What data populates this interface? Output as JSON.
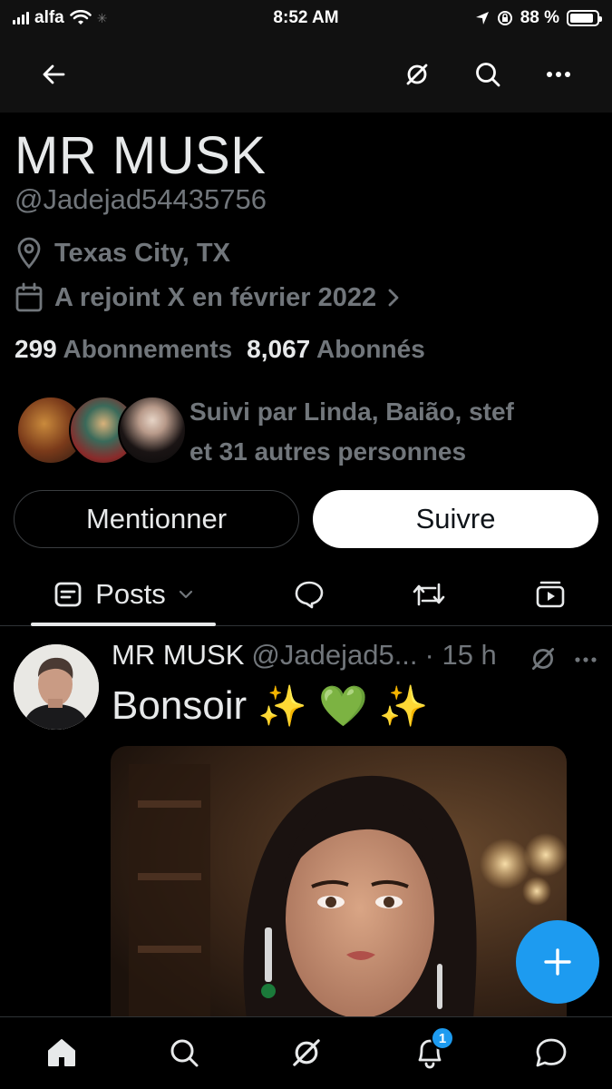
{
  "status_bar": {
    "carrier": "alfa",
    "time": "8:52 AM",
    "battery": "88 %",
    "battery_level": 0.88
  },
  "top_nav": {
    "icons": [
      "back-arrow-icon",
      "grok-icon",
      "search-icon",
      "more-icon"
    ]
  },
  "profile": {
    "name": "MR MUSK",
    "handle": "@Jadejad54435756",
    "location": "Texas City, TX",
    "joined": "A rejoint X en février 2022",
    "following_count": "299",
    "following_label": "Abonnements",
    "followers_count": "8,067",
    "followers_label": "Abonnés",
    "followed_by_line1": "Suivi par Linda, Baião, stef",
    "followed_by_line2": "et 31 autres personnes"
  },
  "actions": {
    "mention_label": "Mentionner",
    "follow_label": "Suivre"
  },
  "tabs": {
    "posts_label": "Posts",
    "icons": [
      "posts-icon",
      "reply-icon",
      "repost-icon",
      "media-icon"
    ]
  },
  "post": {
    "author": "MR MUSK",
    "handle": "@Jadejad5...",
    "time": "· 15 h",
    "text": "Bonsoir",
    "emojis": [
      "✨",
      "💚",
      "✨"
    ]
  },
  "bottom_nav": {
    "icons": [
      "home-icon",
      "search-icon",
      "grok-icon",
      "notifications-icon",
      "messages-icon"
    ],
    "notification_badge": "1"
  },
  "colors": {
    "accent": "#1d9bf0",
    "muted_text": "#71767b",
    "primary_text": "#e7e9ea"
  }
}
